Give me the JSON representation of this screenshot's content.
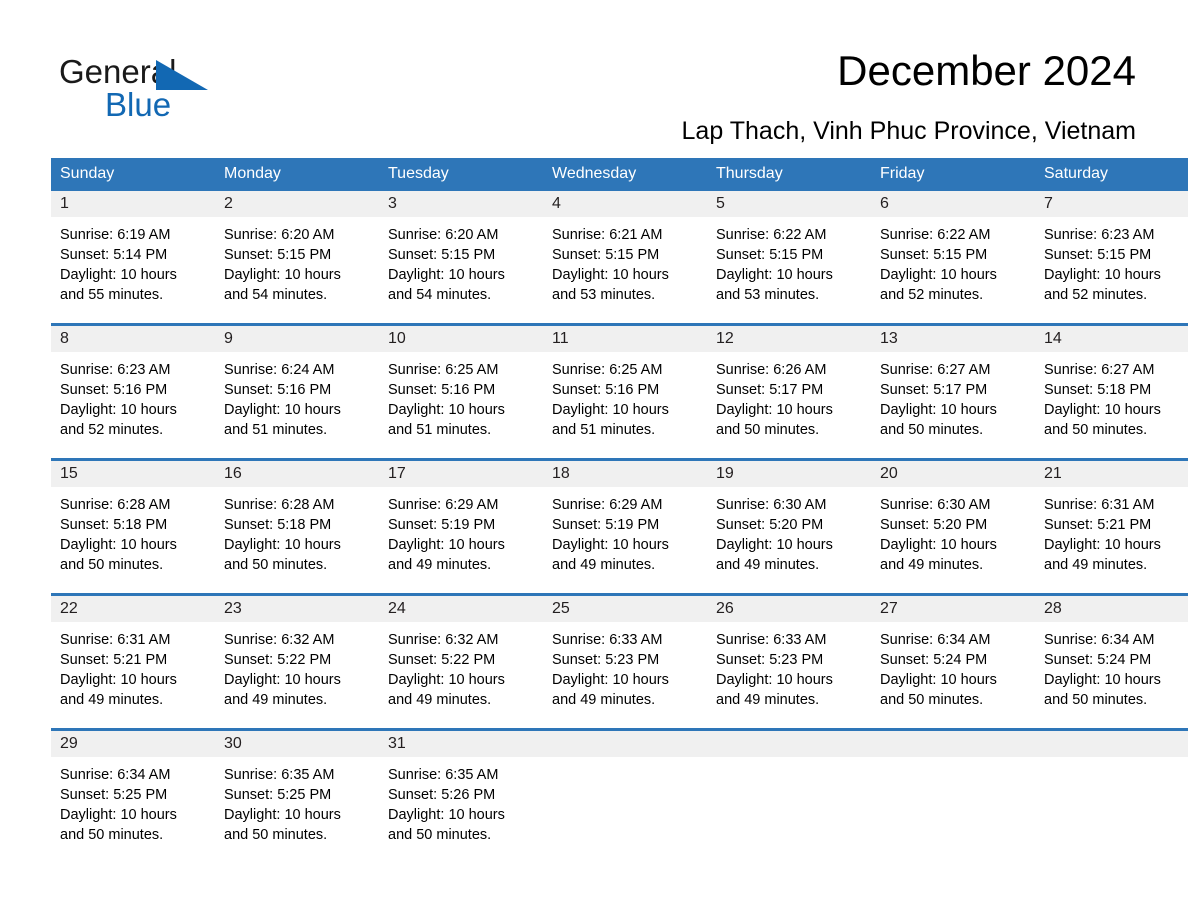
{
  "brand": {
    "name_part1": "General",
    "name_part2": "Blue",
    "triangle_color": "#1268b3",
    "text_color": "#1a1a1a"
  },
  "header": {
    "title": "December 2024",
    "subtitle": "Lap Thach, Vinh Phuc Province, Vietnam"
  },
  "colors": {
    "header_blue": "#2e76b8",
    "daynum_band": "#f0f0f0",
    "row_separator": "#2e76b8",
    "text": "#000000"
  },
  "weekday_headers": [
    "Sunday",
    "Monday",
    "Tuesday",
    "Wednesday",
    "Thursday",
    "Friday",
    "Saturday"
  ],
  "weeks": [
    [
      {
        "day": "1",
        "sunrise": "Sunrise: 6:19 AM",
        "sunset": "Sunset: 5:14 PM",
        "daylight": "Daylight: 10 hours and 55 minutes."
      },
      {
        "day": "2",
        "sunrise": "Sunrise: 6:20 AM",
        "sunset": "Sunset: 5:15 PM",
        "daylight": "Daylight: 10 hours and 54 minutes."
      },
      {
        "day": "3",
        "sunrise": "Sunrise: 6:20 AM",
        "sunset": "Sunset: 5:15 PM",
        "daylight": "Daylight: 10 hours and 54 minutes."
      },
      {
        "day": "4",
        "sunrise": "Sunrise: 6:21 AM",
        "sunset": "Sunset: 5:15 PM",
        "daylight": "Daylight: 10 hours and 53 minutes."
      },
      {
        "day": "5",
        "sunrise": "Sunrise: 6:22 AM",
        "sunset": "Sunset: 5:15 PM",
        "daylight": "Daylight: 10 hours and 53 minutes."
      },
      {
        "day": "6",
        "sunrise": "Sunrise: 6:22 AM",
        "sunset": "Sunset: 5:15 PM",
        "daylight": "Daylight: 10 hours and 52 minutes."
      },
      {
        "day": "7",
        "sunrise": "Sunrise: 6:23 AM",
        "sunset": "Sunset: 5:15 PM",
        "daylight": "Daylight: 10 hours and 52 minutes."
      }
    ],
    [
      {
        "day": "8",
        "sunrise": "Sunrise: 6:23 AM",
        "sunset": "Sunset: 5:16 PM",
        "daylight": "Daylight: 10 hours and 52 minutes."
      },
      {
        "day": "9",
        "sunrise": "Sunrise: 6:24 AM",
        "sunset": "Sunset: 5:16 PM",
        "daylight": "Daylight: 10 hours and 51 minutes."
      },
      {
        "day": "10",
        "sunrise": "Sunrise: 6:25 AM",
        "sunset": "Sunset: 5:16 PM",
        "daylight": "Daylight: 10 hours and 51 minutes."
      },
      {
        "day": "11",
        "sunrise": "Sunrise: 6:25 AM",
        "sunset": "Sunset: 5:16 PM",
        "daylight": "Daylight: 10 hours and 51 minutes."
      },
      {
        "day": "12",
        "sunrise": "Sunrise: 6:26 AM",
        "sunset": "Sunset: 5:17 PM",
        "daylight": "Daylight: 10 hours and 50 minutes."
      },
      {
        "day": "13",
        "sunrise": "Sunrise: 6:27 AM",
        "sunset": "Sunset: 5:17 PM",
        "daylight": "Daylight: 10 hours and 50 minutes."
      },
      {
        "day": "14",
        "sunrise": "Sunrise: 6:27 AM",
        "sunset": "Sunset: 5:18 PM",
        "daylight": "Daylight: 10 hours and 50 minutes."
      }
    ],
    [
      {
        "day": "15",
        "sunrise": "Sunrise: 6:28 AM",
        "sunset": "Sunset: 5:18 PM",
        "daylight": "Daylight: 10 hours and 50 minutes."
      },
      {
        "day": "16",
        "sunrise": "Sunrise: 6:28 AM",
        "sunset": "Sunset: 5:18 PM",
        "daylight": "Daylight: 10 hours and 50 minutes."
      },
      {
        "day": "17",
        "sunrise": "Sunrise: 6:29 AM",
        "sunset": "Sunset: 5:19 PM",
        "daylight": "Daylight: 10 hours and 49 minutes."
      },
      {
        "day": "18",
        "sunrise": "Sunrise: 6:29 AM",
        "sunset": "Sunset: 5:19 PM",
        "daylight": "Daylight: 10 hours and 49 minutes."
      },
      {
        "day": "19",
        "sunrise": "Sunrise: 6:30 AM",
        "sunset": "Sunset: 5:20 PM",
        "daylight": "Daylight: 10 hours and 49 minutes."
      },
      {
        "day": "20",
        "sunrise": "Sunrise: 6:30 AM",
        "sunset": "Sunset: 5:20 PM",
        "daylight": "Daylight: 10 hours and 49 minutes."
      },
      {
        "day": "21",
        "sunrise": "Sunrise: 6:31 AM",
        "sunset": "Sunset: 5:21 PM",
        "daylight": "Daylight: 10 hours and 49 minutes."
      }
    ],
    [
      {
        "day": "22",
        "sunrise": "Sunrise: 6:31 AM",
        "sunset": "Sunset: 5:21 PM",
        "daylight": "Daylight: 10 hours and 49 minutes."
      },
      {
        "day": "23",
        "sunrise": "Sunrise: 6:32 AM",
        "sunset": "Sunset: 5:22 PM",
        "daylight": "Daylight: 10 hours and 49 minutes."
      },
      {
        "day": "24",
        "sunrise": "Sunrise: 6:32 AM",
        "sunset": "Sunset: 5:22 PM",
        "daylight": "Daylight: 10 hours and 49 minutes."
      },
      {
        "day": "25",
        "sunrise": "Sunrise: 6:33 AM",
        "sunset": "Sunset: 5:23 PM",
        "daylight": "Daylight: 10 hours and 49 minutes."
      },
      {
        "day": "26",
        "sunrise": "Sunrise: 6:33 AM",
        "sunset": "Sunset: 5:23 PM",
        "daylight": "Daylight: 10 hours and 49 minutes."
      },
      {
        "day": "27",
        "sunrise": "Sunrise: 6:34 AM",
        "sunset": "Sunset: 5:24 PM",
        "daylight": "Daylight: 10 hours and 50 minutes."
      },
      {
        "day": "28",
        "sunrise": "Sunrise: 6:34 AM",
        "sunset": "Sunset: 5:24 PM",
        "daylight": "Daylight: 10 hours and 50 minutes."
      }
    ],
    [
      {
        "day": "29",
        "sunrise": "Sunrise: 6:34 AM",
        "sunset": "Sunset: 5:25 PM",
        "daylight": "Daylight: 10 hours and 50 minutes."
      },
      {
        "day": "30",
        "sunrise": "Sunrise: 6:35 AM",
        "sunset": "Sunset: 5:25 PM",
        "daylight": "Daylight: 10 hours and 50 minutes."
      },
      {
        "day": "31",
        "sunrise": "Sunrise: 6:35 AM",
        "sunset": "Sunset: 5:26 PM",
        "daylight": "Daylight: 10 hours and 50 minutes."
      },
      {
        "day": "",
        "sunrise": "",
        "sunset": "",
        "daylight": ""
      },
      {
        "day": "",
        "sunrise": "",
        "sunset": "",
        "daylight": ""
      },
      {
        "day": "",
        "sunrise": "",
        "sunset": "",
        "daylight": ""
      },
      {
        "day": "",
        "sunrise": "",
        "sunset": "",
        "daylight": ""
      }
    ]
  ]
}
